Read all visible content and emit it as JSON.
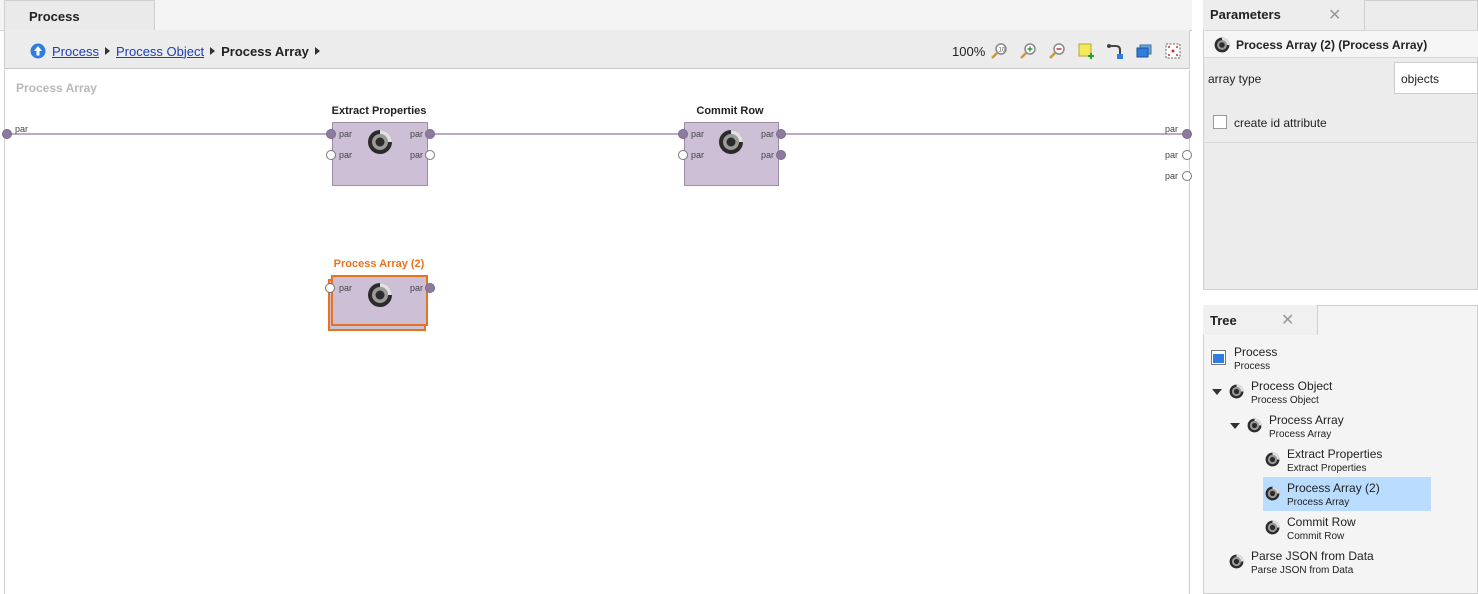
{
  "editor": {
    "tab_label": "Process",
    "breadcrumb": [
      {
        "label": "Process",
        "link": true
      },
      {
        "label": "Process Object",
        "link": true
      },
      {
        "label": "Process Array",
        "link": false
      }
    ],
    "zoom_level": "100%",
    "canvas_title": "Process Array",
    "outer_ports": {
      "in_label": "par",
      "out_labels": [
        "par",
        "par",
        "par"
      ]
    },
    "operators": [
      {
        "title": "Extract Properties",
        "port_labels": [
          "par",
          "par",
          "par",
          "par"
        ]
      },
      {
        "title": "Commit Row",
        "port_labels": [
          "par",
          "par",
          "par",
          "par"
        ]
      },
      {
        "title": "Process Array (2)",
        "port_labels": [
          "par",
          "par"
        ],
        "selected": true
      }
    ]
  },
  "parameters": {
    "tab_label": "Parameters",
    "header": "Process Array (2) (Process Array)",
    "array_type_label": "array type",
    "array_type_value": "objects",
    "create_id_label": "create id attribute",
    "create_id_checked": false
  },
  "tree": {
    "tab_label": "Tree",
    "items": [
      {
        "name": "Process",
        "sub": "Process"
      },
      {
        "name": "Process Object",
        "sub": "Process Object"
      },
      {
        "name": "Process Array",
        "sub": "Process Array"
      },
      {
        "name": "Extract Properties",
        "sub": "Extract Properties"
      },
      {
        "name": "Process Array (2)",
        "sub": "Process Array",
        "selected": true
      },
      {
        "name": "Commit Row",
        "sub": "Commit Row"
      },
      {
        "name": "Parse JSON from Data",
        "sub": "Parse JSON from Data"
      }
    ]
  },
  "colors": {
    "selected_orange": "#e8731f",
    "operator_fill": "#cdbfd6",
    "tree_selection": "#b9dcff",
    "link": "#1a3fb5"
  }
}
